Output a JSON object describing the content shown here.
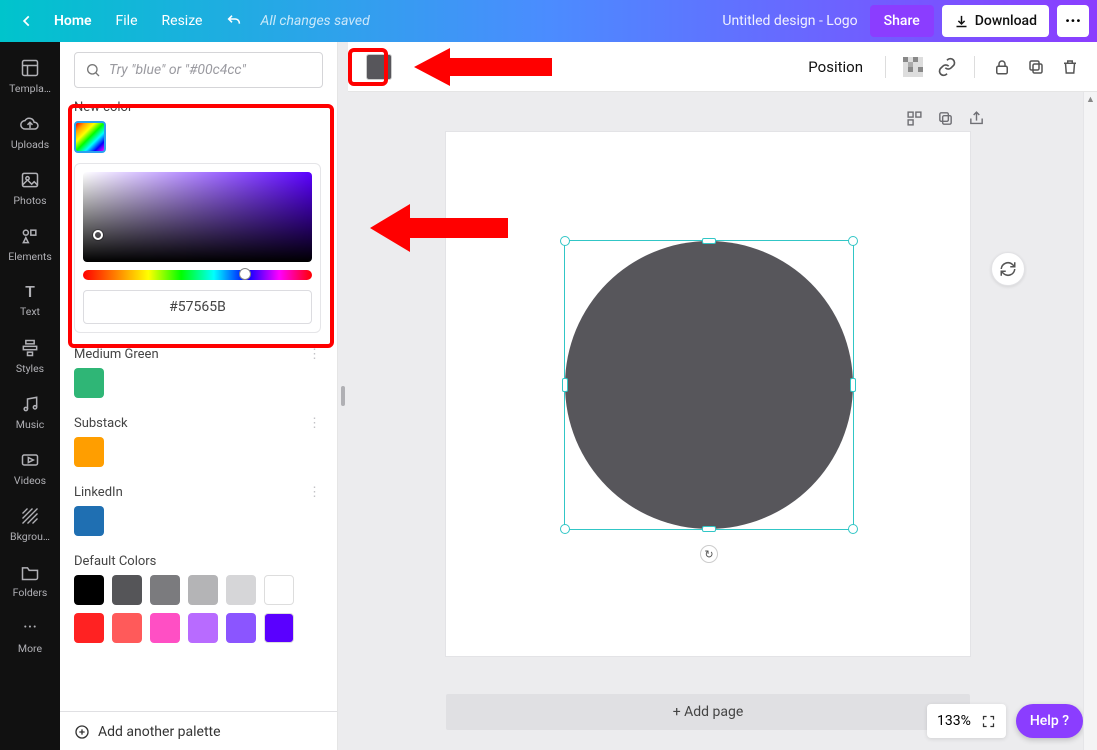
{
  "header": {
    "home": "Home",
    "file": "File",
    "resize": "Resize",
    "saved": "All changes saved",
    "title": "Untitled design - Logo",
    "share": "Share",
    "download": "Download"
  },
  "rail": {
    "templates": "Templa…",
    "uploads": "Uploads",
    "photos": "Photos",
    "elements": "Elements",
    "text": "Text",
    "styles": "Styles",
    "music": "Music",
    "videos": "Videos",
    "background": "Bkgrou…",
    "folders": "Folders",
    "more": "More"
  },
  "color_panel": {
    "search_placeholder": "Try \"blue\" or \"#00c4cc\"",
    "new_color_label": "New color",
    "hex_value": "#57565B",
    "palettes": [
      {
        "name": "Medium Green",
        "colors": [
          "#2fb676"
        ]
      },
      {
        "name": "Substack",
        "colors": [
          "#ff9e00"
        ]
      },
      {
        "name": "LinkedIn",
        "colors": [
          "#1f6fb2"
        ]
      }
    ],
    "default_colors_label": "Default Colors",
    "default_colors_row1": [
      "#000000",
      "#555558",
      "#7b7b7e",
      "#b4b4b6",
      "#d6d6d8",
      "#ffffff"
    ],
    "default_colors_row2": [
      "#ff2222",
      "#ff5a5a",
      "#ff4fc4",
      "#b86bff",
      "#8b55ff",
      "#5a00ff"
    ],
    "add_palette": "Add another palette"
  },
  "toolbar": {
    "position": "Position",
    "current_fill": "#57565B"
  },
  "canvas": {
    "add_page": "+ Add page"
  },
  "footer": {
    "zoom": "133%",
    "help": "Help ?"
  }
}
